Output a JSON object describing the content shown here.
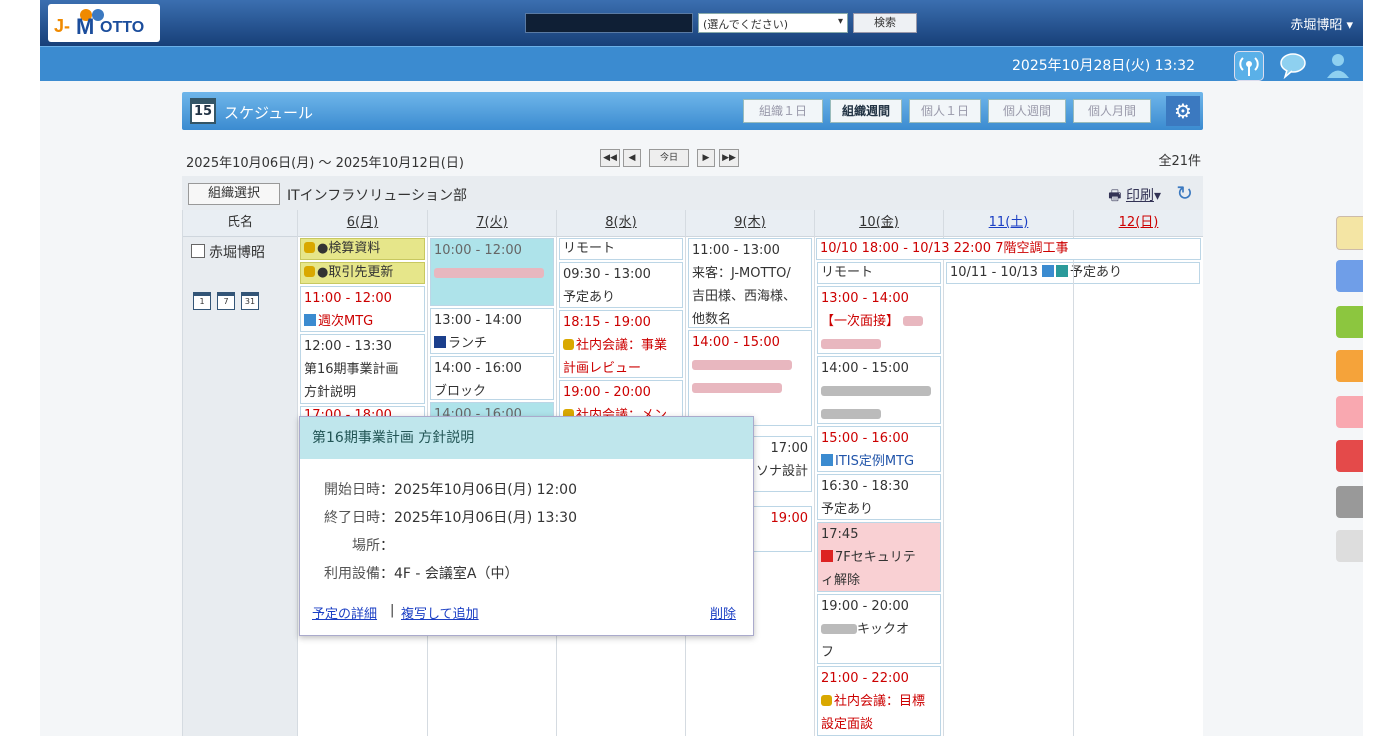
{
  "header": {
    "logo": "J-MOTTO",
    "search_select": "(選んでください)",
    "search_button": "検索",
    "user_name": "赤堀博昭",
    "datetime": "2025年10月28日(火) 13:32"
  },
  "schedule": {
    "title": "スケジュール",
    "views": [
      "組織１日",
      "組織週間",
      "個人１日",
      "個人週間",
      "個人月間"
    ],
    "range": "2025年10月06日(月) ～ 2025年10月12日(日)",
    "nav": [
      "◀◀",
      "◀",
      "今日",
      "▶",
      "▶▶"
    ],
    "count": "全21件",
    "org_button": "組織選択",
    "org_name": "ITインフラソリューション部",
    "print": "印刷",
    "name_header": "氏名",
    "person": "赤堀博昭",
    "mini_icons": [
      "1",
      "7",
      "31"
    ],
    "days": [
      "6(月)",
      "7(火)",
      "8(水)",
      "9(木)",
      "10(金)",
      "11(土)",
      "12(日)"
    ]
  },
  "events": {
    "mon_1": "●検算資料",
    "mon_2": "●取引先更新",
    "mon_3": "11:00 - 12:00",
    "mon_4": "週次MTG",
    "mon_5": "12:00 - 13:30",
    "mon_6": "第16期事業計画",
    "mon_7": "方針説明",
    "mon_8": "17:00 - 18:00",
    "tue_1": "10:00 - 12:00",
    "tue_3": "13:00 - 14:00",
    "tue_4": "ランチ",
    "tue_5": "14:00 - 16:00",
    "tue_6": "ブロック",
    "tue_7": "14:00 - 16:00",
    "wed_1": "リモート",
    "wed_2": "09:30 - 13:00",
    "wed_3": "予定あり",
    "wed_4": "18:15 - 19:00",
    "wed_5": "社内会議：事業",
    "wed_6": "計画レビュー",
    "wed_7": "19:00 - 20:00",
    "wed_8": "社内会議：メン",
    "thu_1": "11:00 - 13:00",
    "thu_2": "来客：J-MOTTO/",
    "thu_3": "吉田様、西海様、",
    "thu_4": "他数名",
    "thu_5": "14:00 - 15:00",
    "thu_6": "17:00",
    "thu_7": "ソナ設計",
    "thu_8": "19:00",
    "fri_span": "10/10 18:00 - 10/13 22:00 7階空調工事",
    "fri_1": "リモート",
    "fri_2": "13:00 - 14:00",
    "fri_3": "【一次面接】",
    "fri_4": "14:00 - 15:00",
    "fri_5": "15:00 - 16:00",
    "fri_6": "ITIS定例MTG",
    "fri_7": "16:30 - 18:30",
    "fri_8": "予定あり",
    "fri_9": "17:45",
    "fri_10": "7Fセキュリテ",
    "fri_11": "ィ解除",
    "fri_12": "19:00 - 20:00",
    "fri_13": "キックオ",
    "fri_14": "フ",
    "fri_15": "21:00 - 22:00",
    "fri_16": "社内会議：目標",
    "fri_17": "設定面談",
    "sat_span": "10/11 - 10/13",
    "sat_text": "予定あり"
  },
  "popup": {
    "title": "第16期事業計画 方針説明",
    "start_label": "開始日時",
    "start_value": "：2025年10月06日(月) 12:00",
    "end_label": "終了日時",
    "end_value": "：2025年10月06日(月) 13:30",
    "place_label": "場所",
    "place_value": "：",
    "equip_label": "利用設備",
    "equip_value": "：4F - 会議室A（中）",
    "detail_link": "予定の詳細",
    "separator": "|",
    "copy_link": "複写して追加",
    "delete_link": "削除"
  },
  "colors": {
    "topbar": "#173f78",
    "subbar": "#3b8bd0",
    "accent_red": "#cc0000",
    "saturday": "#1b3fc4",
    "sunday": "#cc0000"
  }
}
